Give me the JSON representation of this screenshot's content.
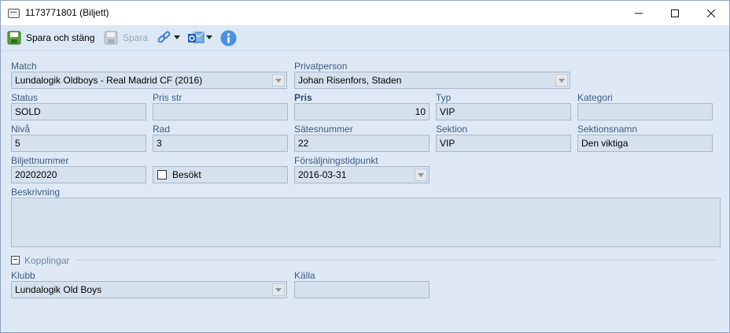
{
  "window": {
    "title": "1173771801 (Biljett)"
  },
  "toolbar": {
    "save_close_label": "Spara och stäng",
    "save_label": "Spara"
  },
  "form": {
    "match": {
      "label": "Match",
      "value": "Lundalogik Oldboys - Real Madrid CF (2016)"
    },
    "privatperson": {
      "label": "Privatperson",
      "value": "Johan Risenfors, Staden"
    },
    "status": {
      "label": "Status",
      "value": "SOLD"
    },
    "pris_str": {
      "label": "Pris str",
      "value": ""
    },
    "pris": {
      "label": "Pris",
      "value": "10"
    },
    "typ": {
      "label": "Typ",
      "value": "VIP"
    },
    "kategori": {
      "label": "Kategori",
      "value": ""
    },
    "niva": {
      "label": "Nivå",
      "value": "5"
    },
    "rad": {
      "label": "Rad",
      "value": "3"
    },
    "satesnummer": {
      "label": "Sätesnummer",
      "value": "22"
    },
    "sektion": {
      "label": "Sektion",
      "value": "VIP"
    },
    "sektionsnamn": {
      "label": "Sektionsnamn",
      "value": "Den viktiga"
    },
    "biljettnummer": {
      "label": "Biljettnummer",
      "value": "20202020"
    },
    "besokt": {
      "label": "Besökt",
      "checked": false
    },
    "forsaljningstidpunkt": {
      "label": "Försäljningstidpunkt",
      "value": "2016-03-31"
    },
    "beskrivning": {
      "label": "Beskrivning",
      "value": ""
    }
  },
  "kopplingar": {
    "section_label": "Kopplingar",
    "collapse_symbol": "−",
    "klubb": {
      "label": "Klubb",
      "value": "Lundalogik Old Boys"
    },
    "kalla": {
      "label": "Källa",
      "value": ""
    }
  },
  "colors": {
    "accent": "#3c5a80",
    "background": "#dfe9f5",
    "field_bg": "#d6e1ee"
  }
}
